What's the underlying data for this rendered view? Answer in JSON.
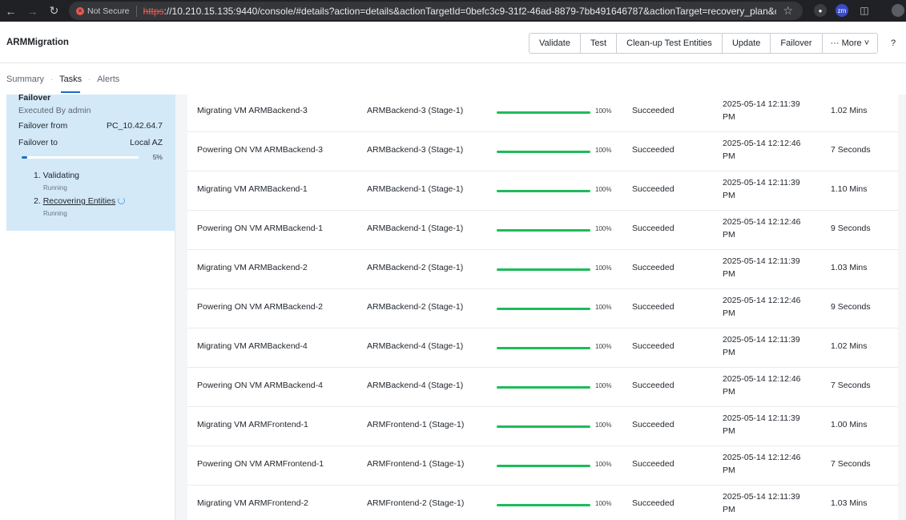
{
  "browser": {
    "back_icon": "arrow-left-icon",
    "forward_icon": "arrow-right-icon",
    "reload_icon": "reload-icon",
    "security_label": "Not Secure",
    "url_scheme": "https",
    "url_rest": "://10.210.15.135:9440/console/#details?action=details&actionTargetId=0befc3c9-31f2-46ad-8879-7bb491646787&actionTarget=recovery_plan&co...",
    "profile_initials": "zm"
  },
  "app": {
    "title": "ARMMigration",
    "actions": [
      {
        "label": "Validate"
      },
      {
        "label": "Test"
      },
      {
        "label": "Clean-up Test Entities"
      },
      {
        "label": "Update"
      },
      {
        "label": "Failover"
      },
      {
        "label": "··· More ˅"
      }
    ],
    "help": "?"
  },
  "tabs": [
    {
      "label": "Summary",
      "active": false
    },
    {
      "label": "Tasks",
      "active": true
    },
    {
      "label": "Alerts",
      "active": false
    }
  ],
  "failover": {
    "title": "Failover",
    "executed_by": "Executed By admin",
    "from_label": "Failover from",
    "from_value": "PC_10.42.64.7",
    "to_label": "Failover to",
    "to_value": "Local AZ",
    "progress_pct": 5,
    "progress_label": "5%",
    "steps": [
      {
        "label": "1. Validating",
        "status": "Running"
      },
      {
        "label": "2.",
        "link": "Recovering Entities",
        "status": "Running"
      }
    ]
  },
  "tasks": [
    {
      "name": "Migrating VM ARMBackend-3",
      "entity": "ARMBackend-3 (Stage-1)",
      "progress": 100,
      "pct": "100%",
      "status": "Succeeded",
      "time1": "2025-05-14 12:11:39",
      "time2": "PM",
      "duration": "1.02 Mins"
    },
    {
      "name": "Powering ON VM ARMBackend-3",
      "entity": "ARMBackend-3 (Stage-1)",
      "progress": 100,
      "pct": "100%",
      "status": "Succeeded",
      "time1": "2025-05-14 12:12:46",
      "time2": "PM",
      "duration": "7 Seconds"
    },
    {
      "name": "Migrating VM ARMBackend-1",
      "entity": "ARMBackend-1 (Stage-1)",
      "progress": 100,
      "pct": "100%",
      "status": "Succeeded",
      "time1": "2025-05-14 12:11:39",
      "time2": "PM",
      "duration": "1.10 Mins"
    },
    {
      "name": "Powering ON VM ARMBackend-1",
      "entity": "ARMBackend-1 (Stage-1)",
      "progress": 100,
      "pct": "100%",
      "status": "Succeeded",
      "time1": "2025-05-14 12:12:46",
      "time2": "PM",
      "duration": "9 Seconds"
    },
    {
      "name": "Migrating VM ARMBackend-2",
      "entity": "ARMBackend-2 (Stage-1)",
      "progress": 100,
      "pct": "100%",
      "status": "Succeeded",
      "time1": "2025-05-14 12:11:39",
      "time2": "PM",
      "duration": "1.03 Mins"
    },
    {
      "name": "Powering ON VM ARMBackend-2",
      "entity": "ARMBackend-2 (Stage-1)",
      "progress": 100,
      "pct": "100%",
      "status": "Succeeded",
      "time1": "2025-05-14 12:12:46",
      "time2": "PM",
      "duration": "9 Seconds"
    },
    {
      "name": "Migrating VM ARMBackend-4",
      "entity": "ARMBackend-4 (Stage-1)",
      "progress": 100,
      "pct": "100%",
      "status": "Succeeded",
      "time1": "2025-05-14 12:11:39",
      "time2": "PM",
      "duration": "1.02 Mins"
    },
    {
      "name": "Powering ON VM ARMBackend-4",
      "entity": "ARMBackend-4 (Stage-1)",
      "progress": 100,
      "pct": "100%",
      "status": "Succeeded",
      "time1": "2025-05-14 12:12:46",
      "time2": "PM",
      "duration": "7 Seconds"
    },
    {
      "name": "Migrating VM ARMFrontend-1",
      "entity": "ARMFrontend-1 (Stage-1)",
      "progress": 100,
      "pct": "100%",
      "status": "Succeeded",
      "time1": "2025-05-14 12:11:39",
      "time2": "PM",
      "duration": "1.00 Mins"
    },
    {
      "name": "Powering ON VM ARMFrontend-1",
      "entity": "ARMFrontend-1 (Stage-1)",
      "progress": 100,
      "pct": "100%",
      "status": "Succeeded",
      "time1": "2025-05-14 12:12:46",
      "time2": "PM",
      "duration": "7 Seconds"
    },
    {
      "name": "Migrating VM ARMFrontend-2",
      "entity": "ARMFrontend-2 (Stage-1)",
      "progress": 100,
      "pct": "100%",
      "status": "Succeeded",
      "time1": "2025-05-14 12:11:39",
      "time2": "PM",
      "duration": "1.03 Mins"
    }
  ],
  "colors": {
    "accent": "#1b6dc6",
    "success_bar": "#1dbc5a",
    "panel_bg": "#d3e9f8"
  }
}
